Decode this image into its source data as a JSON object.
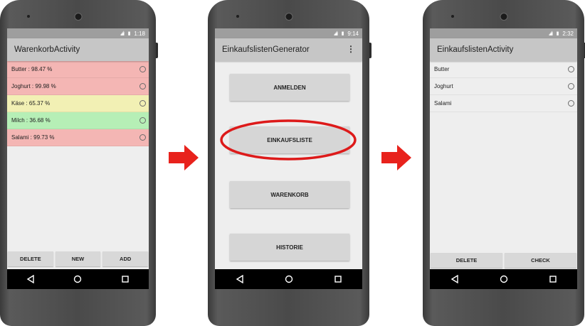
{
  "arrow_color": "#e8221c",
  "highlight_color": "#dd1a1a",
  "screens": [
    {
      "time": "1:18",
      "title": "WarenkorbActivity",
      "items": [
        {
          "label": "Butter : 98.47 %",
          "color": "#f4b6b4"
        },
        {
          "label": "Joghurt : 99.98 %",
          "color": "#f4b6b4"
        },
        {
          "label": "Käse : 65.37 %",
          "color": "#f2f0b4"
        },
        {
          "label": "Milch : 36.68 %",
          "color": "#b6efb6"
        },
        {
          "label": "Salami : 99.73 %",
          "color": "#f4b6b4"
        }
      ],
      "buttons": [
        "DELETE",
        "NEW",
        "ADD"
      ]
    },
    {
      "time": "9:14",
      "title": "EinkaufslistenGenerator",
      "menu_buttons": [
        "ANMELDEN",
        "EINKAUFSLISTE",
        "WARENKORB",
        "HISTORIE"
      ]
    },
    {
      "time": "2:32",
      "title": "EinkaufslistenActivity",
      "items": [
        {
          "label": "Butter"
        },
        {
          "label": "Joghurt"
        },
        {
          "label": "Salami"
        }
      ],
      "buttons": [
        "DELETE",
        "CHECK"
      ]
    }
  ],
  "icons": {
    "signal": "signal-off-icon",
    "battery": "battery-icon",
    "back": "back-icon",
    "home": "home-icon",
    "recents": "recents-icon",
    "overflow": "overflow-menu-icon",
    "arrow": "right-arrow-icon"
  }
}
